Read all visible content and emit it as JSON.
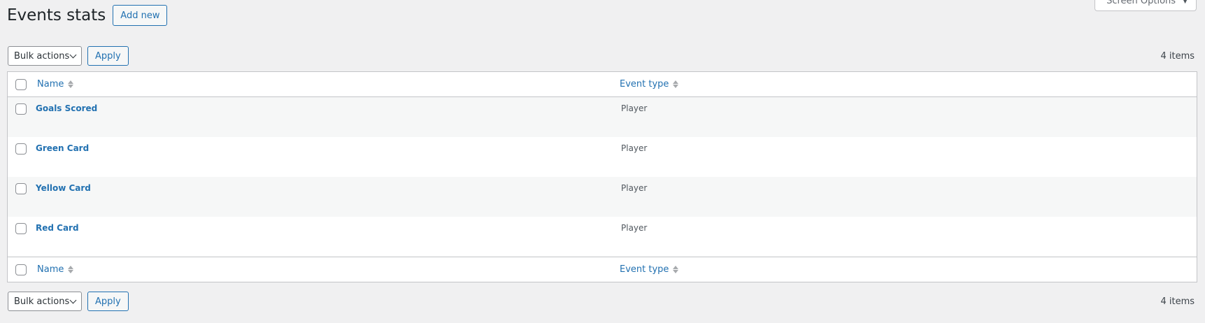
{
  "screen_options": {
    "label": "Screen Options",
    "arrow": "▼"
  },
  "header": {
    "title": "Events stats",
    "add_new": "Add new"
  },
  "tablenav_top": {
    "bulk_actions": "Bulk actions",
    "apply": "Apply",
    "count": "4 items"
  },
  "table": {
    "columns": {
      "name": "Name",
      "event_type": "Event type"
    },
    "rows": [
      {
        "name": "Goals Scored",
        "event_type": "Player"
      },
      {
        "name": "Green Card",
        "event_type": "Player"
      },
      {
        "name": "Yellow Card",
        "event_type": "Player"
      },
      {
        "name": "Red Card",
        "event_type": "Player"
      }
    ]
  },
  "tablenav_bottom": {
    "bulk_actions": "Bulk actions",
    "apply": "Apply",
    "count": "4 items"
  },
  "colors": {
    "link": "#2271b1",
    "background": "#f0f0f1",
    "alt_row": "#f6f7f7"
  }
}
